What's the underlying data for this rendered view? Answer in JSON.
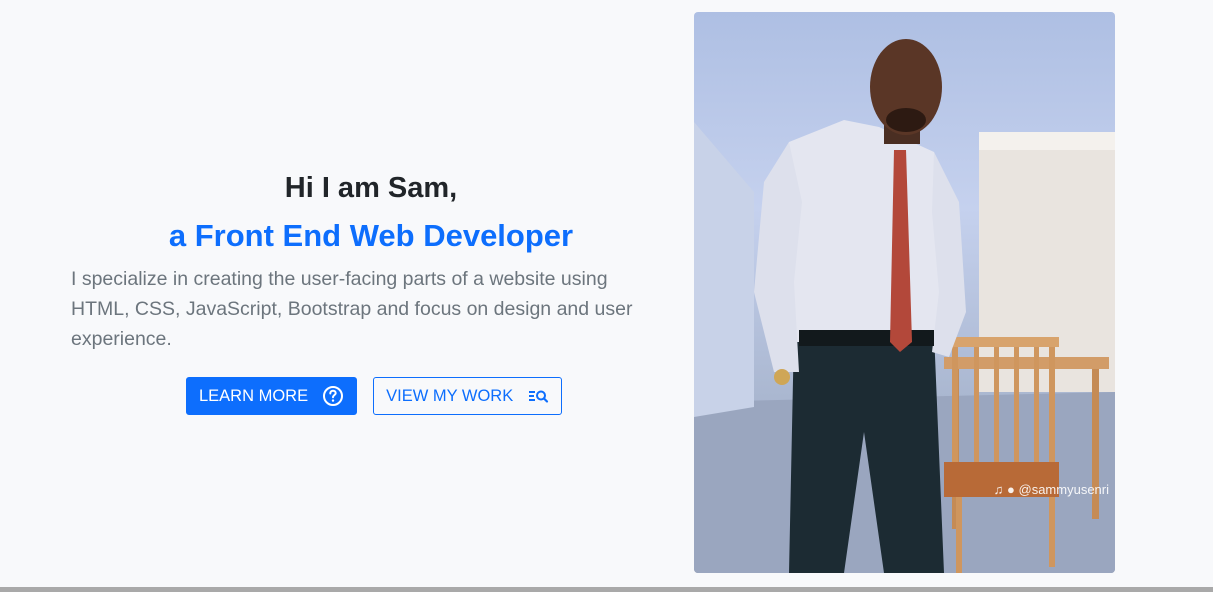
{
  "hero": {
    "title": "Hi I am Sam,",
    "subtitle": "a Front End Web Developer",
    "description": "I specialize in creating the user-facing parts of a website using HTML, CSS, JavaScript, Bootstrap and focus on design and user experience."
  },
  "buttons": {
    "learn_more": "LEARN MORE",
    "view_work": "VIEW MY WORK"
  },
  "photo": {
    "watermark": "@sammyusenri",
    "icons": [
      "tiktok-icon",
      "user-icon"
    ]
  },
  "colors": {
    "primary": "#0d6efd",
    "heading": "#212529",
    "text_muted": "#6c757d",
    "background": "#f8f9fb"
  }
}
